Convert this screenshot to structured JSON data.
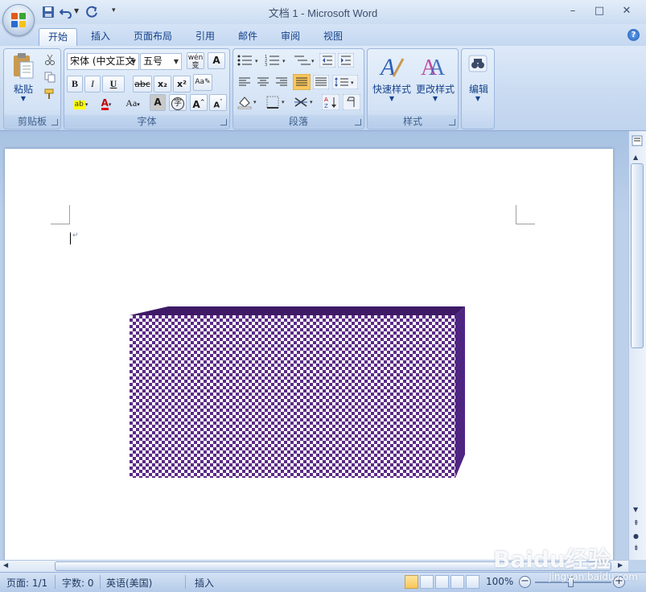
{
  "window": {
    "title": "文档 1 - Microsoft Word",
    "controls": {
      "minimize": "–",
      "maximize": "□",
      "close": "✕"
    }
  },
  "quick_access": {
    "items": [
      "save-icon",
      "undo-icon",
      "redo-icon",
      "customize-icon"
    ]
  },
  "tabs": [
    {
      "label": "开始",
      "active": true
    },
    {
      "label": "插入"
    },
    {
      "label": "页面布局"
    },
    {
      "label": "引用"
    },
    {
      "label": "邮件"
    },
    {
      "label": "审阅"
    },
    {
      "label": "视图"
    }
  ],
  "ribbon": {
    "clipboard": {
      "label": "剪贴板",
      "paste_label": "粘贴"
    },
    "font": {
      "label": "字体",
      "font_name": "宋体 (中文正文",
      "font_size": "五号",
      "bold": "B",
      "italic": "I",
      "underline": "U",
      "strike": "abc",
      "subscript": "x₂",
      "superscript": "x²",
      "change_case": "Aa",
      "grow": "A",
      "shrink": "A",
      "char_border": "A",
      "enclose": "字",
      "phonetic": "wén",
      "clear": "A"
    },
    "paragraph": {
      "label": "段落"
    },
    "styles": {
      "label": "样式",
      "quick_styles": "快速样式",
      "change_styles": "更改样式"
    },
    "editing": {
      "label": "编辑"
    }
  },
  "document": {
    "shape": {
      "type": "3d-box",
      "fill_pattern": "checkerboard",
      "colors": {
        "primary": "#5b2a86",
        "secondary": "#ffffff",
        "side": "#4f2582",
        "top": "#3e1a66"
      }
    }
  },
  "statusbar": {
    "page": "页面: 1/1",
    "words": "字数: 0",
    "language": "英语(美国)",
    "mode": "插入",
    "zoom": "100%"
  },
  "watermark": {
    "text": "Baidu经验",
    "subtext": "jingyan.baidu.com"
  }
}
